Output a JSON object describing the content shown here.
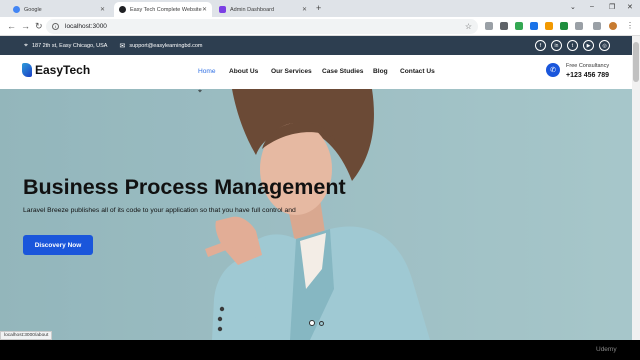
{
  "browser": {
    "tabs": [
      {
        "title": "Google",
        "favicon": "#4285f4",
        "active": false
      },
      {
        "title": "Easy Tech Complete Website",
        "favicon": "#202124",
        "active": true
      },
      {
        "title": "Admin Dashboard",
        "favicon": "#7b3fe4",
        "active": false
      }
    ],
    "new_tab": "+",
    "url": "localhost:3000",
    "status_url": "localhost:3000/about"
  },
  "topbar": {
    "address": "187 2th st, Easy Chicago, USA",
    "email": "support@easylearningbd.com",
    "social_icons": [
      "facebook-icon",
      "linkedin-icon",
      "twitter-icon",
      "youtube-icon",
      "instagram-icon"
    ]
  },
  "nav": {
    "logo_text": "EasyTech",
    "menu": [
      "Home",
      "About Us",
      "Our Services",
      "Case Studies",
      "Blog",
      "Contact Us"
    ],
    "active_index": 0,
    "consult_label": "Free Consultancy",
    "phone": "+123 456 789"
  },
  "hero": {
    "title": "Business Process Management",
    "subtitle": "Laravel Breeze publishes all of its code to your application so that you have full control and",
    "cta": "Discovery Now",
    "slides": 2,
    "active_slide": 0
  },
  "colors": {
    "topbar": "#2d3e50",
    "accent": "#1a56db",
    "active_menu": "#2f6fe4"
  },
  "watermark": "Udemy"
}
